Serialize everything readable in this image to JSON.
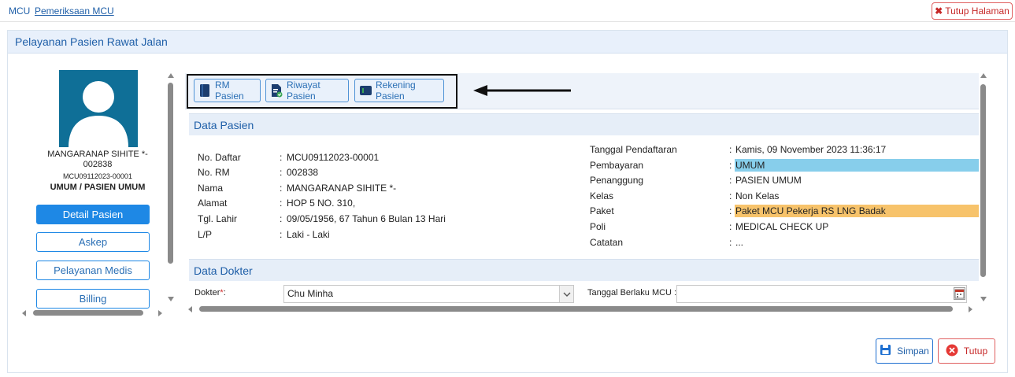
{
  "breadcrumb": {
    "root": "MCU",
    "page": "Pemeriksaan MCU"
  },
  "header": {
    "close_page_label": "Tutup Halaman"
  },
  "panel": {
    "title": "Pelayanan Pasien Rawat Jalan"
  },
  "patient": {
    "name_line1": "MANGARANAP SIHITE *-",
    "name_line2": "002838",
    "registration_code": "MCU09112023-00001",
    "type": "UMUM / PASIEN UMUM"
  },
  "side_nav": [
    "Detail Pasien",
    "Askep",
    "Pelayanan Medis",
    "Billing"
  ],
  "toolbar": {
    "rm": "RM Pasien",
    "riwayat": "Riwayat Pasien",
    "rekening": "Rekening Pasien"
  },
  "data_pasien": {
    "title": "Data Pasien",
    "left": [
      {
        "label": "No. Daftar",
        "value": "MCU09112023-00001"
      },
      {
        "label": "No. RM",
        "value": "002838"
      },
      {
        "label": "Nama",
        "value": "MANGARANAP SIHITE *-"
      },
      {
        "label": "Alamat",
        "value": "HOP 5 NO. 310,"
      },
      {
        "label": "Tgl. Lahir",
        "value": "09/05/1956, 67 Tahun 6 Bulan 13 Hari"
      },
      {
        "label": "L/P",
        "value": "Laki - Laki"
      }
    ],
    "right": [
      {
        "label": "Tanggal Pendaftaran",
        "value": "Kamis, 09 November 2023 11:36:17"
      },
      {
        "label": "Pembayaran",
        "value": "UMUM"
      },
      {
        "label": "Penanggung",
        "value": "PASIEN UMUM"
      },
      {
        "label": "Kelas",
        "value": "Non Kelas"
      },
      {
        "label": "Paket",
        "value": "Paket MCU Pekerja RS LNG Badak"
      },
      {
        "label": "Poli",
        "value": "MEDICAL CHECK UP"
      },
      {
        "label": "Catatan",
        "value": "..."
      }
    ],
    "separator": ":"
  },
  "data_dokter": {
    "title": "Data Dokter",
    "doctor_label": "Dokter",
    "required_mark": "*",
    "doctor_label_suffix": ":",
    "doctor_value": "Chu Minha",
    "date_label": "Tanggal Berlaku MCU :",
    "date_value": ""
  },
  "footer": {
    "save": "Simpan",
    "close": "Tutup"
  },
  "colors": {
    "accent": "#1e88e5",
    "payment_highlight": "#87ceeb",
    "package_highlight": "#f7c36b",
    "danger": "#c62828"
  },
  "icons": [
    "user-avatar-icon",
    "folder-icon",
    "document-check-icon",
    "wallet-icon",
    "save-icon",
    "close-circle-icon",
    "calendar-icon",
    "x-icon",
    "chevron-down-icon"
  ]
}
